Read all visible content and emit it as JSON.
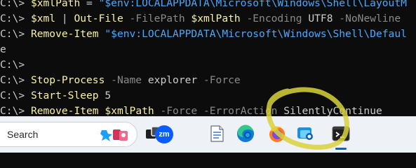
{
  "terminal": {
    "prompt": "C:\\> ",
    "lines": [
      {
        "segments": [
          {
            "t": "cmd",
            "text": "$xmlPath"
          },
          {
            "t": "plain",
            "text": " = "
          },
          {
            "t": "str",
            "text": "\"$env:LOCALAPPDATA\\Microsoft\\Windows\\Shell\\LayoutM"
          }
        ]
      },
      {
        "segments": [
          {
            "t": "cmd",
            "text": "$xml"
          },
          {
            "t": "plain",
            "text": " | "
          },
          {
            "t": "cmd",
            "text": "Out-File"
          },
          {
            "t": "param",
            "text": " -FilePath "
          },
          {
            "t": "cmd",
            "text": "$xmlPath"
          },
          {
            "t": "param",
            "text": " -Encoding "
          },
          {
            "t": "plain",
            "text": "UTF8"
          },
          {
            "t": "param",
            "text": " -NoNewline"
          }
        ]
      },
      {
        "segments": [
          {
            "t": "cmd",
            "text": "Remove-Item"
          },
          {
            "t": "plain",
            "text": " "
          },
          {
            "t": "str",
            "text": "\"$env:LOCALAPPDATA\\Microsoft\\Windows\\Shell\\Defaul"
          }
        ]
      },
      {
        "continuation": "e"
      },
      {
        "segments": []
      },
      {
        "segments": [
          {
            "t": "cmd",
            "text": "Stop-Process"
          },
          {
            "t": "param",
            "text": " -Name "
          },
          {
            "t": "plain",
            "text": "explorer"
          },
          {
            "t": "param",
            "text": " -Force"
          }
        ]
      },
      {
        "segments": [
          {
            "t": "cmd",
            "text": "Start-Sleep"
          },
          {
            "t": "plain",
            "text": " 5"
          }
        ]
      },
      {
        "segments": [
          {
            "t": "cmd",
            "text": "Remove-Item"
          },
          {
            "t": "plain",
            "text": " "
          },
          {
            "t": "cmd",
            "text": "$xmlPath"
          },
          {
            "t": "param",
            "text": " -Force -ErrorAction "
          },
          {
            "t": "plain",
            "text": "SilentlyContinue"
          }
        ]
      },
      {
        "segments": []
      }
    ]
  },
  "taskbar": {
    "search_label": "Search",
    "zoom_label": "zm",
    "icons": [
      "task-view-icon",
      "zoom-icon",
      "notepad-icon",
      "edge-icon",
      "firefox-icon",
      "snipping-tool-icon",
      "terminal-icon"
    ],
    "active_app": "terminal-icon",
    "accent_color": "#0067c0"
  },
  "annotation": {
    "color": "#d8d23a",
    "shape": "hand-drawn circle around firefox and snipping tool icons"
  }
}
